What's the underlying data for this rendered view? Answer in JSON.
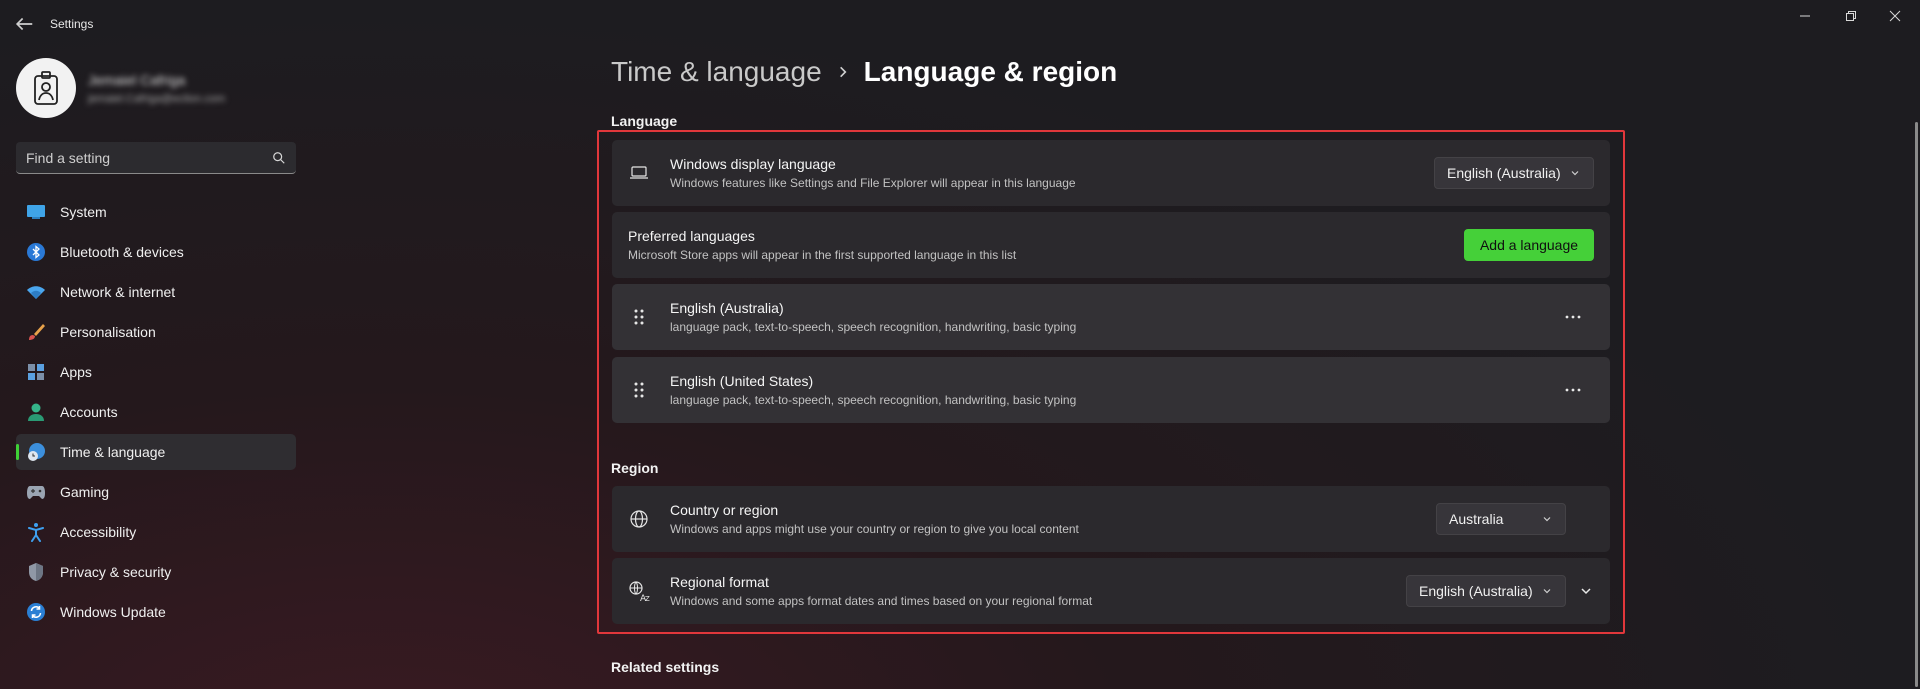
{
  "window": {
    "title": "Settings"
  },
  "profile": {
    "name": "Jemaiel Cafriga",
    "email": "jemaiel.Cafriga@eclion.com"
  },
  "search": {
    "placeholder": "Find a setting"
  },
  "sidebar": {
    "items": [
      {
        "label": "System",
        "icon": "monitor-icon",
        "active": false
      },
      {
        "label": "Bluetooth & devices",
        "icon": "bluetooth-icon",
        "active": false
      },
      {
        "label": "Network & internet",
        "icon": "wifi-icon",
        "active": false
      },
      {
        "label": "Personalisation",
        "icon": "brush-icon",
        "active": false
      },
      {
        "label": "Apps",
        "icon": "apps-icon",
        "active": false
      },
      {
        "label": "Accounts",
        "icon": "person-icon",
        "active": false
      },
      {
        "label": "Time & language",
        "icon": "globe-clock-icon",
        "active": true
      },
      {
        "label": "Gaming",
        "icon": "gamepad-icon",
        "active": false
      },
      {
        "label": "Accessibility",
        "icon": "accessibility-icon",
        "active": false
      },
      {
        "label": "Privacy & security",
        "icon": "shield-icon",
        "active": false
      },
      {
        "label": "Windows Update",
        "icon": "update-icon",
        "active": false
      }
    ]
  },
  "breadcrumb": {
    "parent": "Time & language",
    "current": "Language & region"
  },
  "language": {
    "section_label": "Language",
    "display_language": {
      "title": "Windows display language",
      "subtitle": "Windows features like Settings and File Explorer will appear in this language",
      "value": "English (Australia)"
    },
    "preferred": {
      "title": "Preferred languages",
      "subtitle": "Microsoft Store apps will appear in the first supported language in this list",
      "button": "Add a language"
    },
    "items": [
      {
        "title": "English (Australia)",
        "subtitle": "language pack, text-to-speech, speech recognition, handwriting, basic typing"
      },
      {
        "title": "English (United States)",
        "subtitle": "language pack, text-to-speech, speech recognition, handwriting, basic typing"
      }
    ]
  },
  "region": {
    "section_label": "Region",
    "country": {
      "title": "Country or region",
      "subtitle": "Windows and apps might use your country or region to give you local content",
      "value": "Australia"
    },
    "format": {
      "title": "Regional format",
      "subtitle": "Windows and some apps format dates and times based on your regional format",
      "value": "English (Australia)"
    }
  },
  "related": {
    "section_label": "Related settings"
  },
  "colors": {
    "accent": "#45d039",
    "highlight": "#e1373b"
  }
}
